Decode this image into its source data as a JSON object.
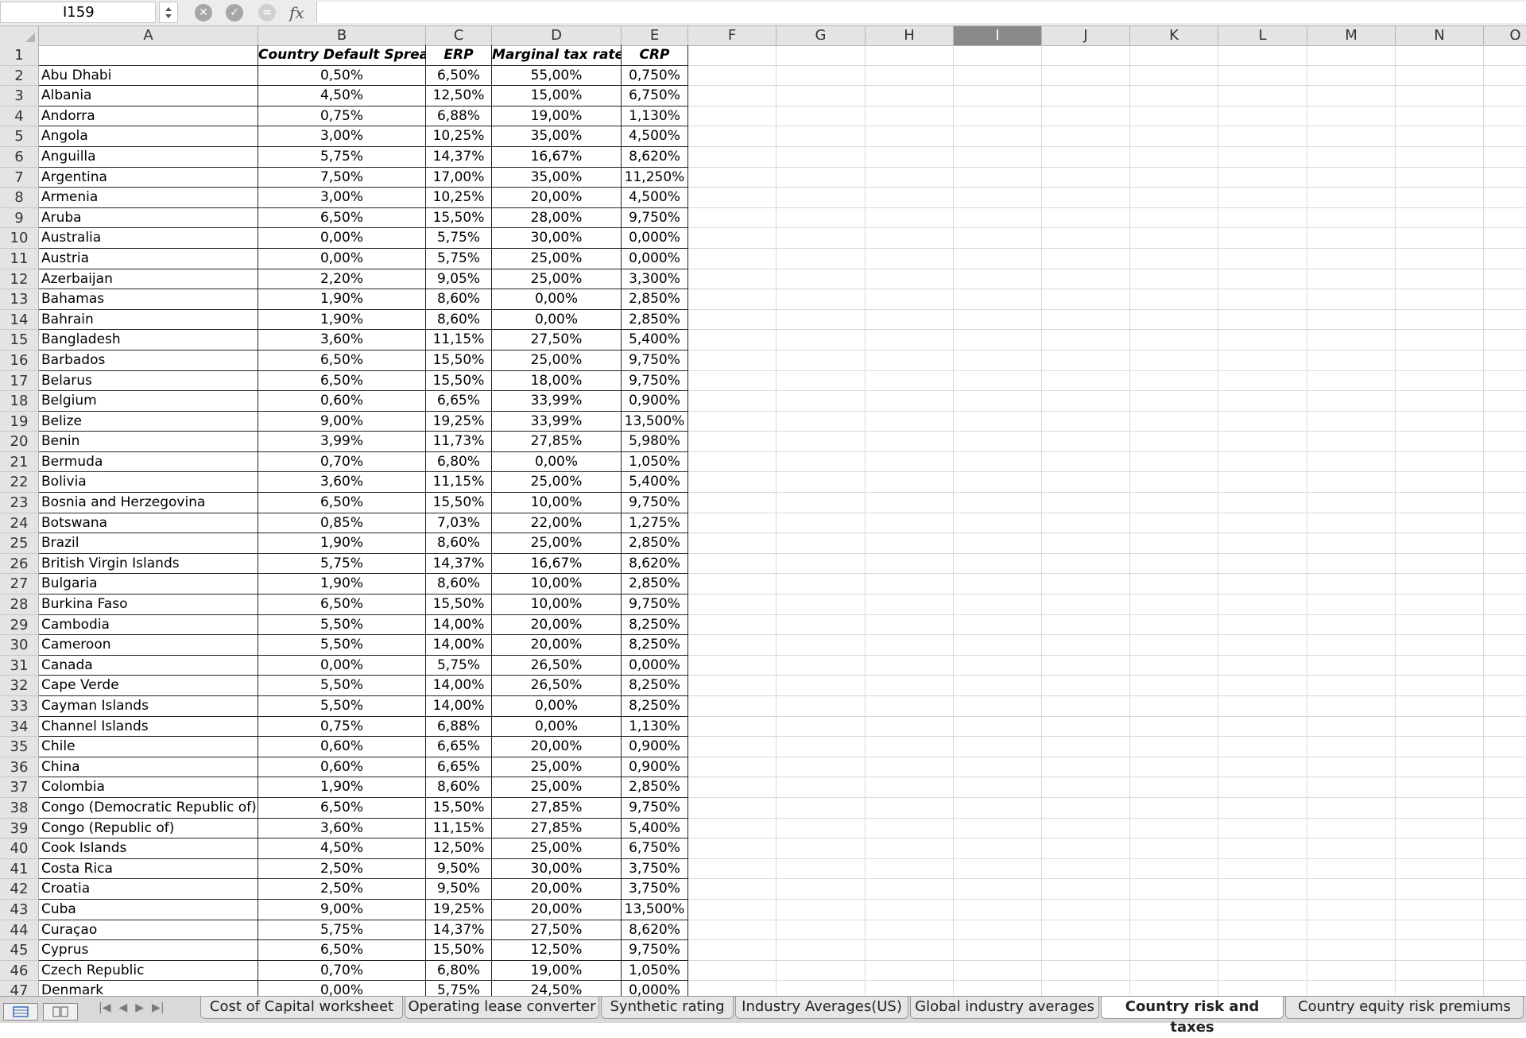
{
  "name_box": "I159",
  "formula_icons": [
    "cancel-icon",
    "confirm-icon",
    "function-icon"
  ],
  "formula_label": "fx",
  "columns": [
    "A",
    "B",
    "C",
    "D",
    "E",
    "F",
    "G",
    "H",
    "I",
    "J",
    "K",
    "L",
    "M",
    "N",
    "O"
  ],
  "selected_column": "I",
  "header_row": [
    "",
    "Country Default Spread",
    "ERP",
    "Marginal tax rate",
    "CRP"
  ],
  "rows": [
    [
      "Abu Dhabi",
      "0,50%",
      "6,50%",
      "55,00%",
      "0,750%"
    ],
    [
      "Albania",
      "4,50%",
      "12,50%",
      "15,00%",
      "6,750%"
    ],
    [
      "Andorra",
      "0,75%",
      "6,88%",
      "19,00%",
      "1,130%"
    ],
    [
      "Angola",
      "3,00%",
      "10,25%",
      "35,00%",
      "4,500%"
    ],
    [
      "Anguilla",
      "5,75%",
      "14,37%",
      "16,67%",
      "8,620%"
    ],
    [
      "Argentina",
      "7,50%",
      "17,00%",
      "35,00%",
      "11,250%"
    ],
    [
      "Armenia",
      "3,00%",
      "10,25%",
      "20,00%",
      "4,500%"
    ],
    [
      "Aruba",
      "6,50%",
      "15,50%",
      "28,00%",
      "9,750%"
    ],
    [
      "Australia",
      "0,00%",
      "5,75%",
      "30,00%",
      "0,000%"
    ],
    [
      "Austria",
      "0,00%",
      "5,75%",
      "25,00%",
      "0,000%"
    ],
    [
      "Azerbaijan",
      "2,20%",
      "9,05%",
      "25,00%",
      "3,300%"
    ],
    [
      "Bahamas",
      "1,90%",
      "8,60%",
      "0,00%",
      "2,850%"
    ],
    [
      "Bahrain",
      "1,90%",
      "8,60%",
      "0,00%",
      "2,850%"
    ],
    [
      "Bangladesh",
      "3,60%",
      "11,15%",
      "27,50%",
      "5,400%"
    ],
    [
      "Barbados",
      "6,50%",
      "15,50%",
      "25,00%",
      "9,750%"
    ],
    [
      "Belarus",
      "6,50%",
      "15,50%",
      "18,00%",
      "9,750%"
    ],
    [
      "Belgium",
      "0,60%",
      "6,65%",
      "33,99%",
      "0,900%"
    ],
    [
      "Belize",
      "9,00%",
      "19,25%",
      "33,99%",
      "13,500%"
    ],
    [
      "Benin",
      "3,99%",
      "11,73%",
      "27,85%",
      "5,980%"
    ],
    [
      "Bermuda",
      "0,70%",
      "6,80%",
      "0,00%",
      "1,050%"
    ],
    [
      "Bolivia",
      "3,60%",
      "11,15%",
      "25,00%",
      "5,400%"
    ],
    [
      "Bosnia and Herzegovina",
      "6,50%",
      "15,50%",
      "10,00%",
      "9,750%"
    ],
    [
      "Botswana",
      "0,85%",
      "7,03%",
      "22,00%",
      "1,275%"
    ],
    [
      "Brazil",
      "1,90%",
      "8,60%",
      "25,00%",
      "2,850%"
    ],
    [
      "British Virgin Islands",
      "5,75%",
      "14,37%",
      "16,67%",
      "8,620%"
    ],
    [
      "Bulgaria",
      "1,90%",
      "8,60%",
      "10,00%",
      "2,850%"
    ],
    [
      "Burkina Faso",
      "6,50%",
      "15,50%",
      "10,00%",
      "9,750%"
    ],
    [
      "Cambodia",
      "5,50%",
      "14,00%",
      "20,00%",
      "8,250%"
    ],
    [
      "Cameroon",
      "5,50%",
      "14,00%",
      "20,00%",
      "8,250%"
    ],
    [
      "Canada",
      "0,00%",
      "5,75%",
      "26,50%",
      "0,000%"
    ],
    [
      "Cape Verde",
      "5,50%",
      "14,00%",
      "26,50%",
      "8,250%"
    ],
    [
      "Cayman Islands",
      "5,50%",
      "14,00%",
      "0,00%",
      "8,250%"
    ],
    [
      "Channel Islands",
      "0,75%",
      "6,88%",
      "0,00%",
      "1,130%"
    ],
    [
      "Chile",
      "0,60%",
      "6,65%",
      "20,00%",
      "0,900%"
    ],
    [
      "China",
      "0,60%",
      "6,65%",
      "25,00%",
      "0,900%"
    ],
    [
      "Colombia",
      "1,90%",
      "8,60%",
      "25,00%",
      "2,850%"
    ],
    [
      "Congo (Democratic Republic of)",
      "6,50%",
      "15,50%",
      "27,85%",
      "9,750%"
    ],
    [
      "Congo (Republic of)",
      "3,60%",
      "11,15%",
      "27,85%",
      "5,400%"
    ],
    [
      "Cook Islands",
      "4,50%",
      "12,50%",
      "25,00%",
      "6,750%"
    ],
    [
      "Costa Rica",
      "2,50%",
      "9,50%",
      "30,00%",
      "3,750%"
    ],
    [
      "Croatia",
      "2,50%",
      "9,50%",
      "20,00%",
      "3,750%"
    ],
    [
      "Cuba",
      "9,00%",
      "19,25%",
      "20,00%",
      "13,500%"
    ],
    [
      "Curaçao",
      "5,75%",
      "14,37%",
      "27,50%",
      "8,620%"
    ],
    [
      "Cyprus",
      "6,50%",
      "15,50%",
      "12,50%",
      "9,750%"
    ],
    [
      "Czech Republic",
      "0,70%",
      "6,80%",
      "19,00%",
      "1,050%"
    ],
    [
      "Denmark",
      "0,00%",
      "5,75%",
      "24,50%",
      "0,000%"
    ]
  ],
  "sheet_tabs": [
    "Cost of Capital worksheet",
    "Operating lease converter",
    "Synthetic rating",
    "Industry Averages(US)",
    "Global industry averages",
    "Country risk and taxes",
    "Country equity risk premiums"
  ],
  "active_tab": "Country risk and taxes"
}
